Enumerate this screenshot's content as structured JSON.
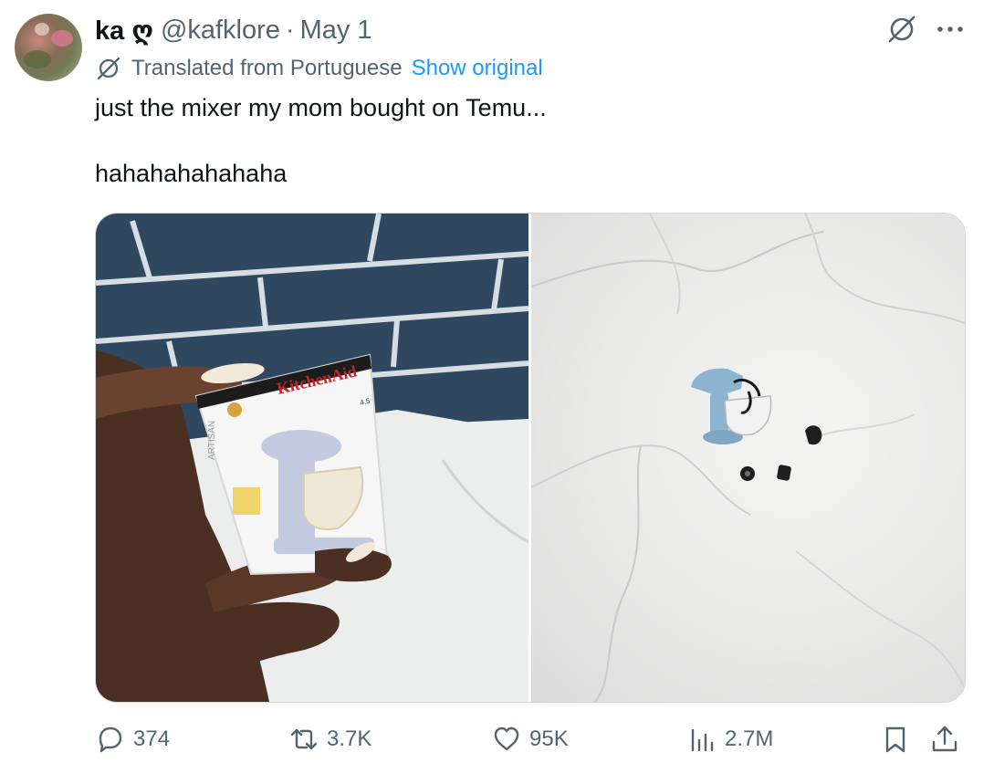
{
  "author": {
    "display_name": "ka ღ",
    "handle": "@kafklore",
    "separator": "·",
    "date": "May 1"
  },
  "translation": {
    "label": "Translated from Portuguese",
    "link": "Show original"
  },
  "tweet": {
    "lines": [
      "just the mixer my mom bought on Temu...",
      "hahahahahahaha"
    ]
  },
  "media": {
    "box_brand": "KitchenAid",
    "box_side": "ARTISAN",
    "box_capacity": "4.5"
  },
  "actions": {
    "replies": "374",
    "reposts": "3.7K",
    "likes": "95K",
    "views": "2.7M"
  },
  "icons": {
    "grok": "grok-icon",
    "more": "more-icon",
    "reply": "reply-icon",
    "repost": "repost-icon",
    "like": "like-icon",
    "views": "views-icon",
    "bookmark": "bookmark-icon",
    "share": "share-icon"
  },
  "colors": {
    "text": "#0f1419",
    "secondary": "#536471",
    "link": "#1d9bf0",
    "border": "#cfd9de"
  }
}
